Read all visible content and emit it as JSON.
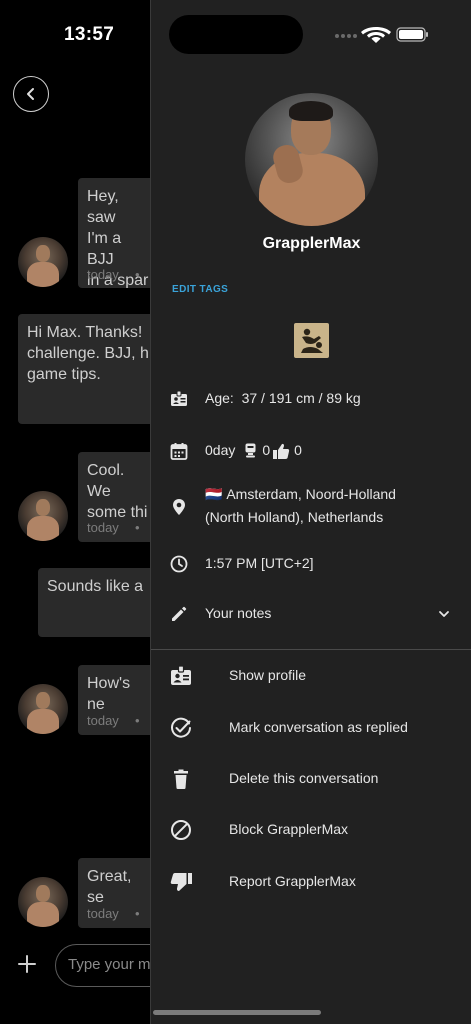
{
  "status_bar": {
    "time": "13:57"
  },
  "chat": {
    "messages": [
      {
        "lines": [
          "Hey, saw",
          "I'm a BJJ",
          "in a spar"
        ],
        "meta": "today"
      },
      {
        "lines": [
          "Hi Max. Thanks!",
          "challenge. BJJ, h",
          "game tips."
        ],
        "meta": ""
      },
      {
        "lines": [
          "Cool. We",
          "some thi"
        ],
        "meta": "today"
      },
      {
        "lines": [
          "Sounds like a"
        ],
        "meta": ""
      },
      {
        "lines": [
          "How's ne"
        ],
        "meta": "today"
      },
      {
        "lines": [
          "Great, se"
        ],
        "meta": "today"
      }
    ],
    "input_placeholder": "Type your m"
  },
  "drawer": {
    "username": "GrapplerMax",
    "edit_tags": "EDIT TAGS",
    "info": {
      "age_label": "Age:",
      "age_value": "37 / 191 cm / 89 kg",
      "days": "0day",
      "count_a": "0",
      "count_b": "0",
      "flag": "🇳🇱",
      "location_line1": "Amsterdam, Noord-Holland",
      "location_line2": "(North Holland), Netherlands",
      "local_time": "1:57 PM [UTC+2]",
      "notes": "Your notes"
    },
    "actions": [
      {
        "label": "Show profile",
        "icon": "profile-card-icon"
      },
      {
        "label": "Mark conversation as replied",
        "icon": "check-circle-icon"
      },
      {
        "label": "Delete this conversation",
        "icon": "trash-icon"
      },
      {
        "label": "Block GrapplerMax",
        "icon": "block-icon"
      },
      {
        "label": "Report GrapplerMax",
        "icon": "thumbs-down-icon"
      }
    ]
  },
  "colors": {
    "drawer_bg": "#212121",
    "accent_link": "#3aa3d9",
    "bubble_bg": "#2a2a2a"
  }
}
